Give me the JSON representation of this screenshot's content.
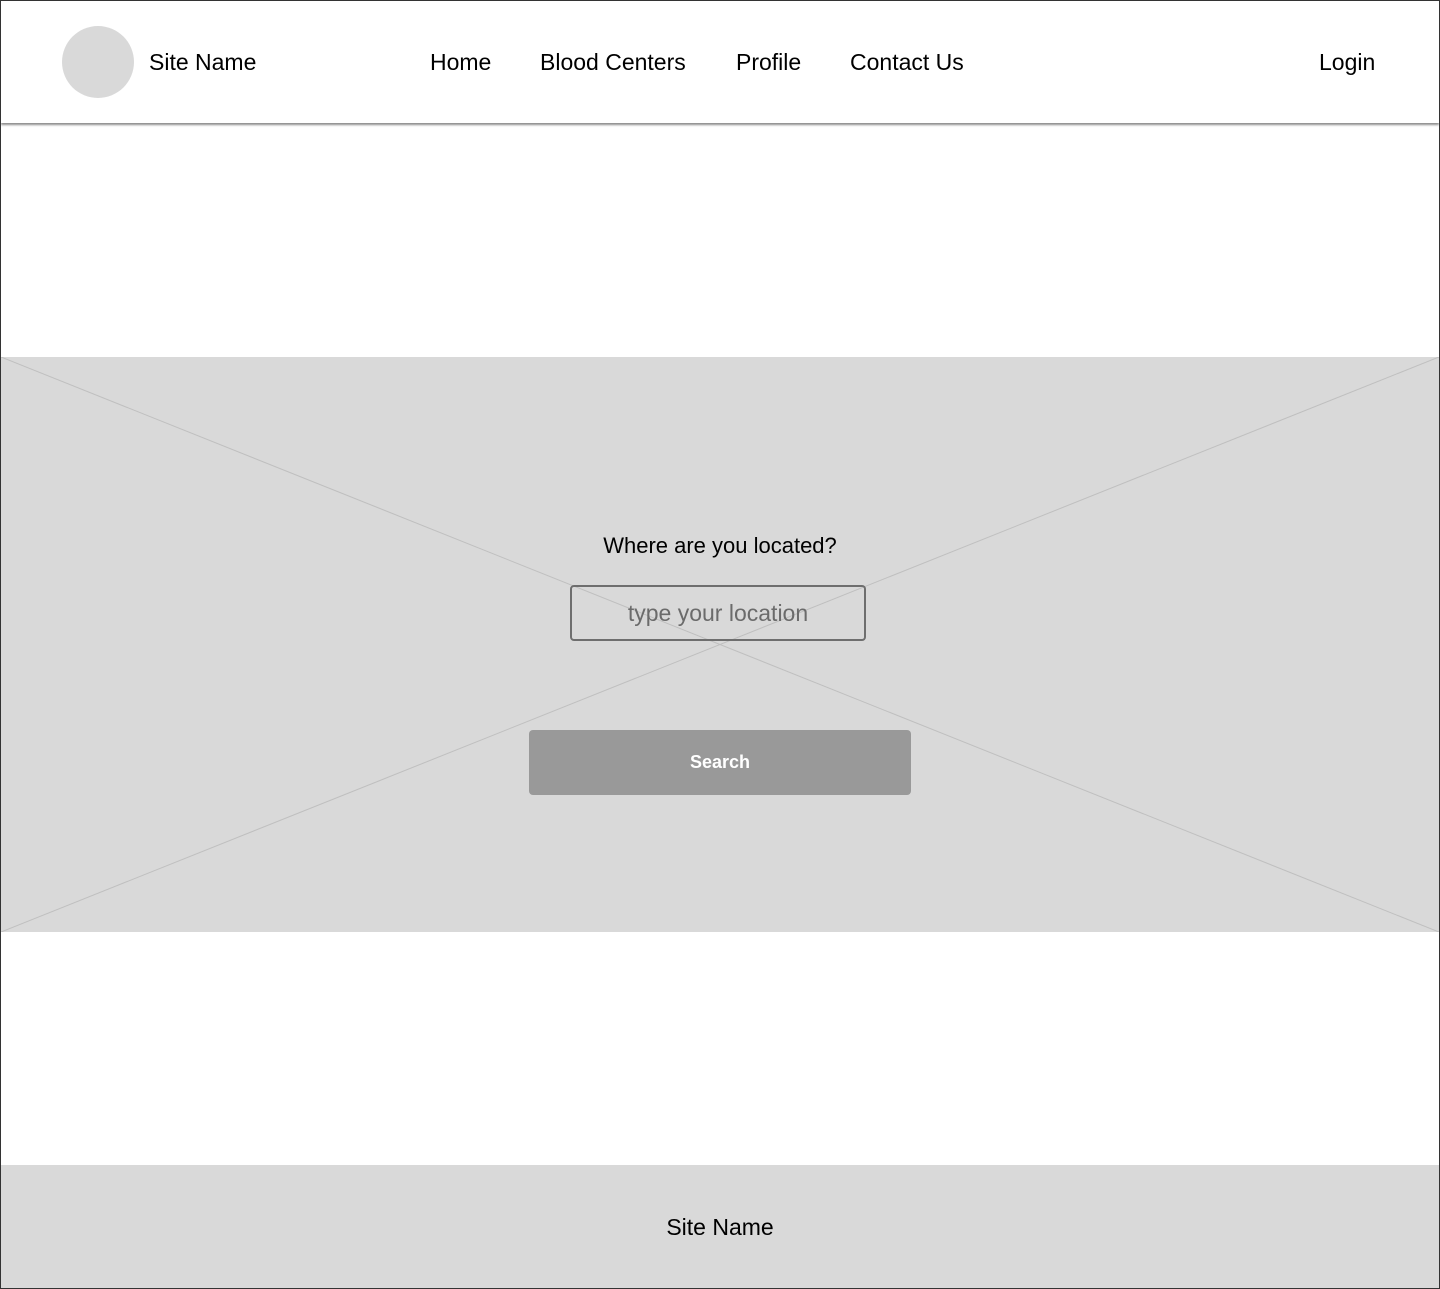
{
  "header": {
    "logo_icon": "circle-placeholder",
    "site_name": "Site Name",
    "nav": [
      {
        "label": "Home"
      },
      {
        "label": "Blood Centers"
      },
      {
        "label": "Profile"
      },
      {
        "label": "Contact Us"
      }
    ],
    "login_label": "Login"
  },
  "hero": {
    "background_icon": "image-placeholder-x",
    "question": "Where are you located?",
    "location_input": {
      "value": "",
      "placeholder": "type your location"
    },
    "search_label": "Search"
  },
  "footer": {
    "site_name": "Site Name"
  },
  "colors": {
    "placeholder_gray": "#d9d9d9",
    "button_gray": "#999999",
    "input_border": "#6e6e6e"
  }
}
